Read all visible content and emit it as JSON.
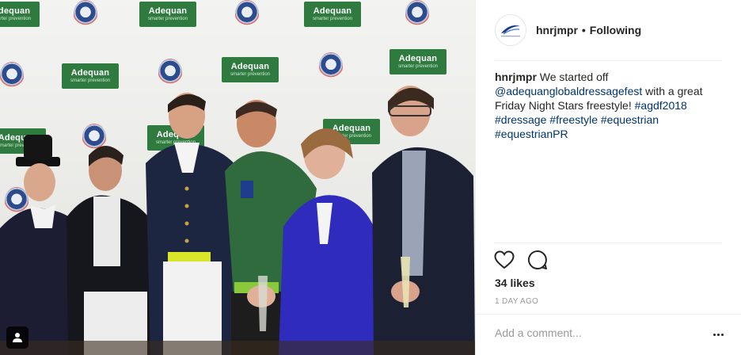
{
  "post": {
    "photo_alt": "",
    "backdrop": {
      "sponsor_logo_text": "Adequan",
      "sponsor_logo_sub": "smarter prevention"
    }
  },
  "header": {
    "username": "hnrjmpr",
    "separator": "•",
    "follow_status": "Following",
    "avatar_icon": "brand-logo-icon"
  },
  "caption": {
    "username": "hnrjmpr",
    "text_intro": "We started off",
    "mention": "@adequanglobaldressagefest",
    "text_mid": "with a great Friday Night Stars freestyle!",
    "hashtags": [
      "#agdf2018",
      "#dressage",
      "#freestyle",
      "#equestrian",
      "#equestrianPR"
    ]
  },
  "actions": {
    "like_icon": "heart-icon",
    "comment_icon": "comment-bubble-icon"
  },
  "stats": {
    "likes": "34 likes",
    "time_ago": "1 DAY AGO"
  },
  "comment_box": {
    "placeholder": "Add a comment...",
    "more_icon": "more-options-icon"
  },
  "colors": {
    "sponsor_green": "#2f7a3f",
    "link": "#003569",
    "text": "#262626",
    "muted": "#999999",
    "divider": "#efefef"
  }
}
